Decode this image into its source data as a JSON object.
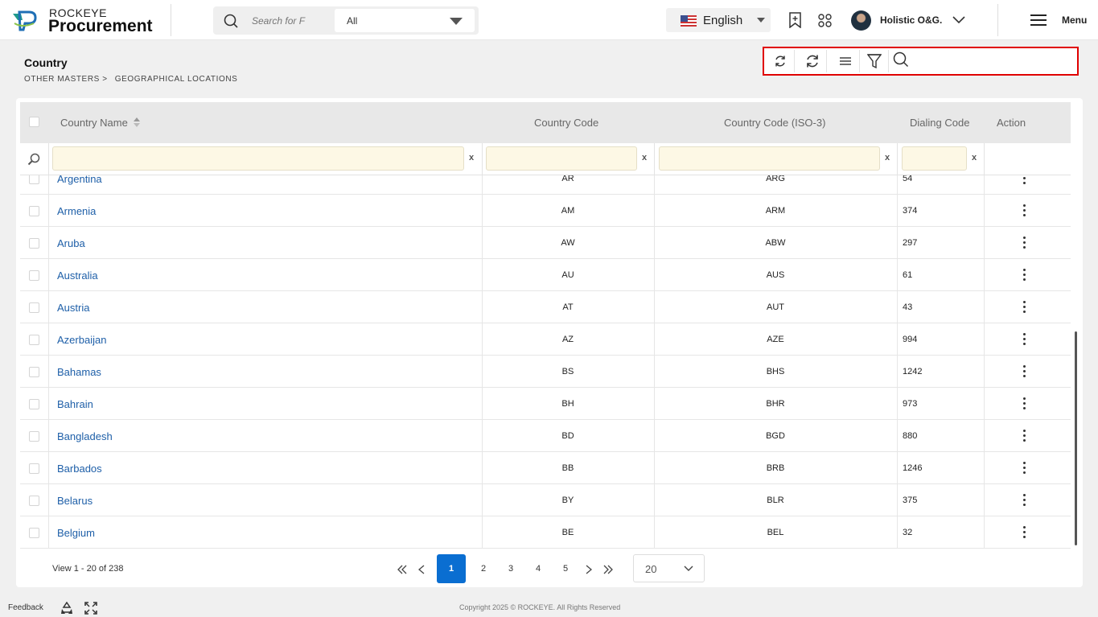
{
  "header": {
    "brand_top": "ROCKEYE",
    "brand_main": "Procurement",
    "search_placeholder": "Search for F",
    "search_scope": "All",
    "language": "English",
    "user_name": "Holistic O&G.",
    "menu_label": "Menu"
  },
  "page": {
    "title": "Country",
    "breadcrumb": [
      "OTHER MASTERS >",
      "GEOGRAPHICAL LOCATIONS"
    ]
  },
  "table": {
    "columns": [
      "Country Name",
      "Country Code",
      "Country Code (ISO-3)",
      "Dialing Code",
      "Action"
    ],
    "rows": [
      {
        "name": "Argentina",
        "code": "AR",
        "iso3": "ARG",
        "dial": "54"
      },
      {
        "name": "Armenia",
        "code": "AM",
        "iso3": "ARM",
        "dial": "374"
      },
      {
        "name": "Aruba",
        "code": "AW",
        "iso3": "ABW",
        "dial": "297"
      },
      {
        "name": "Australia",
        "code": "AU",
        "iso3": "AUS",
        "dial": "61"
      },
      {
        "name": "Austria",
        "code": "AT",
        "iso3": "AUT",
        "dial": "43"
      },
      {
        "name": "Azerbaijan",
        "code": "AZ",
        "iso3": "AZE",
        "dial": "994"
      },
      {
        "name": "Bahamas",
        "code": "BS",
        "iso3": "BHS",
        "dial": "1242"
      },
      {
        "name": "Bahrain",
        "code": "BH",
        "iso3": "BHR",
        "dial": "973"
      },
      {
        "name": "Bangladesh",
        "code": "BD",
        "iso3": "BGD",
        "dial": "880"
      },
      {
        "name": "Barbados",
        "code": "BB",
        "iso3": "BRB",
        "dial": "1246"
      },
      {
        "name": "Belarus",
        "code": "BY",
        "iso3": "BLR",
        "dial": "375"
      },
      {
        "name": "Belgium",
        "code": "BE",
        "iso3": "BEL",
        "dial": "32"
      }
    ],
    "clear_symbol": "x"
  },
  "pagination": {
    "view_info": "View 1 - 20 of 238",
    "pages": [
      "1",
      "2",
      "3",
      "4",
      "5"
    ],
    "current_page": "1",
    "page_size": "20"
  },
  "footer": {
    "feedback": "Feedback",
    "copyright": "Copyright 2025 © ROCKEYE. All Rights Reserved"
  },
  "colors": {
    "accent": "#0a6ed1",
    "link": "#1e5fa8",
    "highlight_border": "#e00000",
    "filter_bg": "#fdf8e5"
  }
}
